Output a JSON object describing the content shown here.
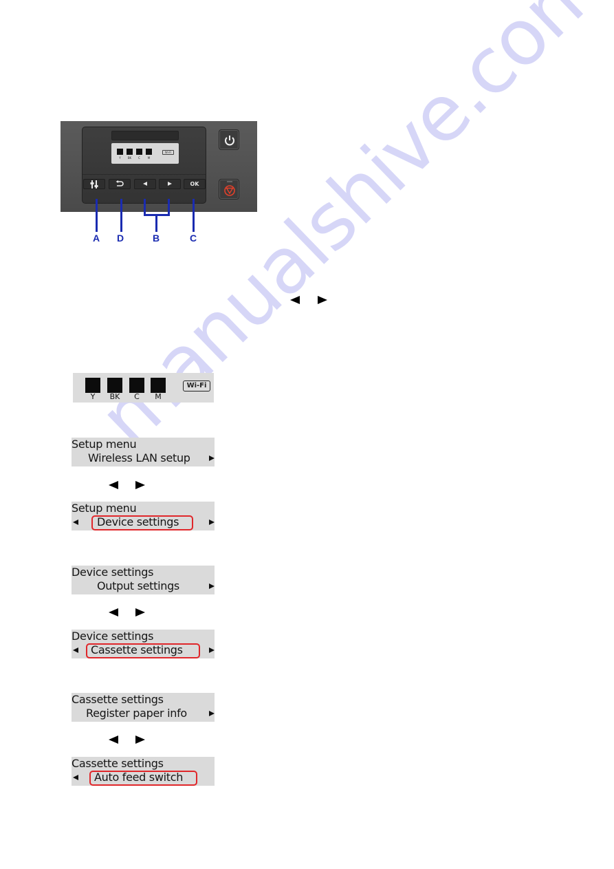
{
  "printer_panel": {
    "mini_display": {
      "ink_labels": [
        "Y",
        "BK",
        "C",
        "M"
      ],
      "wifi_label": "Wi-Fi"
    },
    "buttons": [
      {
        "key": "setup",
        "glyph": "⚒",
        "callout": "A"
      },
      {
        "key": "back",
        "glyph": "↶",
        "callout": "D"
      },
      {
        "key": "left",
        "glyph": "◀",
        "callout": "B"
      },
      {
        "key": "right",
        "glyph": "▶",
        "callout": "B"
      },
      {
        "key": "ok",
        "glyph": "OK",
        "callout": "C"
      }
    ],
    "callouts": {
      "a": "A",
      "d": "D",
      "b": "B",
      "c": "C"
    },
    "side_buttons": [
      "power",
      "stop"
    ],
    "colors": {
      "callout": "#1a2bb0",
      "stop_icon": "#e5402a"
    }
  },
  "home_screen": {
    "ink_labels": [
      "Y",
      "BK",
      "C",
      "M"
    ],
    "wifi_label": "Wi-Fi"
  },
  "screens": [
    {
      "title": "Setup menu",
      "item": "Wireless LAN setup",
      "left_arrow": false,
      "right_arrow": true,
      "selected": false
    },
    {
      "title": "Setup menu",
      "item": "Device settings",
      "left_arrow": true,
      "right_arrow": true,
      "selected": true
    },
    {
      "title": "Device settings",
      "item": "Output settings",
      "left_arrow": false,
      "right_arrow": true,
      "selected": false
    },
    {
      "title": "Device settings",
      "item": "Cassette settings",
      "left_arrow": true,
      "right_arrow": true,
      "selected": true
    },
    {
      "title": "Cassette settings",
      "item": "Register paper info",
      "left_arrow": false,
      "right_arrow": true,
      "selected": false
    },
    {
      "title": "Cassette settings",
      "item": "Auto feed switch",
      "left_arrow": true,
      "right_arrow": false,
      "selected": true
    }
  ],
  "highlight_color": "#e0262a",
  "watermark": "manualshive.com"
}
